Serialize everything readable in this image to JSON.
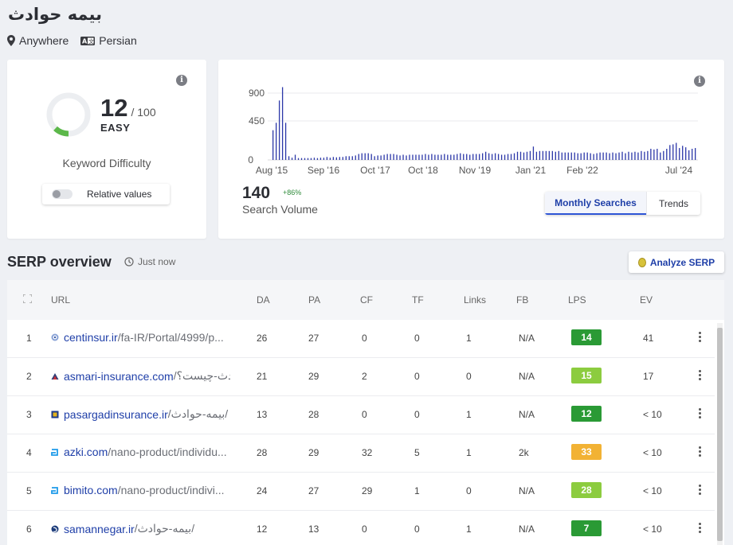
{
  "keyword": {
    "title": "بیمه حوادث",
    "location": "Anywhere",
    "language": "Persian"
  },
  "kd": {
    "score": "12",
    "max": "/ 100",
    "level": "EASY",
    "caption": "Keyword Difficulty",
    "toggle_label": "Relative values",
    "fill_fraction": 0.12,
    "color": "#5cb84a"
  },
  "volume": {
    "value": "140",
    "change": "+86%",
    "caption": "Search Volume",
    "tab_monthly": "Monthly Searches",
    "tab_trends": "Trends",
    "y_ticks": [
      "900",
      "450",
      "0"
    ],
    "x_ticks": [
      "Aug '15",
      "Sep '16",
      "Oct '17",
      "Oct '18",
      "Nov '19",
      "Jan '21",
      "Feb '22",
      "Jul '24"
    ],
    "bar_color": "#2b37a8"
  },
  "chart_data": {
    "type": "bar",
    "title": "",
    "xlabel": "",
    "ylabel": "",
    "ylim": [
      0,
      1000
    ],
    "categories": [
      "Aug '15",
      "Sep '16",
      "Oct '17",
      "Oct '18",
      "Nov '19",
      "Jan '21",
      "Feb '22",
      "Jul '24"
    ],
    "values": [
      400,
      500,
      800,
      980,
      500,
      50,
      30,
      70,
      25,
      25,
      25,
      25,
      25,
      30,
      25,
      30,
      30,
      40,
      30,
      40,
      35,
      40,
      40,
      50,
      50,
      50,
      60,
      80,
      90,
      90,
      90,
      80,
      50,
      60,
      60,
      70,
      80,
      80,
      80,
      70,
      60,
      70,
      60,
      70,
      70,
      70,
      70,
      70,
      80,
      70,
      80,
      70,
      70,
      70,
      80,
      70,
      70,
      70,
      80,
      90,
      80,
      80,
      70,
      80,
      80,
      80,
      90,
      110,
      90,
      80,
      90,
      80,
      70,
      70,
      80,
      80,
      90,
      110,
      110,
      100,
      110,
      120,
      180,
      110,
      120,
      120,
      120,
      120,
      120,
      110,
      120,
      100,
      100,
      100,
      100,
      100,
      90,
      90,
      100,
      100,
      90,
      80,
      90,
      100,
      100,
      100,
      90,
      100,
      90,
      100,
      110,
      90,
      110,
      100,
      110,
      100,
      120,
      110,
      120,
      150,
      140,
      150,
      100,
      120,
      150,
      200,
      210,
      230,
      160,
      190,
      170,
      130,
      150,
      160
    ]
  },
  "serp": {
    "title": "SERP overview",
    "time": "Just now",
    "analyze_label": "Analyze SERP",
    "columns": [
      "URL",
      "DA",
      "PA",
      "CF",
      "TF",
      "Links",
      "FB",
      "LPS",
      "EV"
    ],
    "rows": [
      {
        "rank": "1",
        "domain": "centinsur.ir",
        "path": "/fa-IR/Portal/4999/p...",
        "da": "26",
        "pa": "27",
        "cf": "0",
        "tf": "0",
        "links": "1",
        "fb": "N/A",
        "lps": "14",
        "lps_color": "#2a9a35",
        "ev": "41"
      },
      {
        "rank": "2",
        "domain": "asmari-insurance.com",
        "path": "/بیمه-حوادث-چیست؟",
        "da": "21",
        "pa": "29",
        "cf": "2",
        "tf": "0",
        "links": "0",
        "fb": "N/A",
        "lps": "15",
        "lps_color": "#8ccc3f",
        "ev": "17"
      },
      {
        "rank": "3",
        "domain": "pasargadinsurance.ir",
        "path": "/بیمه-حوادث/",
        "da": "13",
        "pa": "28",
        "cf": "0",
        "tf": "0",
        "links": "1",
        "fb": "N/A",
        "lps": "12",
        "lps_color": "#2a9a35",
        "ev": "< 10"
      },
      {
        "rank": "4",
        "domain": "azki.com",
        "path": "/nano-product/individu...",
        "da": "28",
        "pa": "29",
        "cf": "32",
        "tf": "5",
        "links": "1",
        "fb": "2k",
        "lps": "33",
        "lps_color": "#f2b234",
        "ev": "< 10"
      },
      {
        "rank": "5",
        "domain": "bimito.com",
        "path": "/nano-product/indivi...",
        "da": "24",
        "pa": "27",
        "cf": "29",
        "tf": "1",
        "links": "0",
        "fb": "N/A",
        "lps": "28",
        "lps_color": "#8ccc3f",
        "ev": "< 10"
      },
      {
        "rank": "6",
        "domain": "samannegar.ir",
        "path": "/بیمه-حوادث/",
        "da": "12",
        "pa": "13",
        "cf": "0",
        "tf": "0",
        "links": "1",
        "fb": "N/A",
        "lps": "7",
        "lps_color": "#2a9a35",
        "ev": "< 10"
      }
    ]
  }
}
